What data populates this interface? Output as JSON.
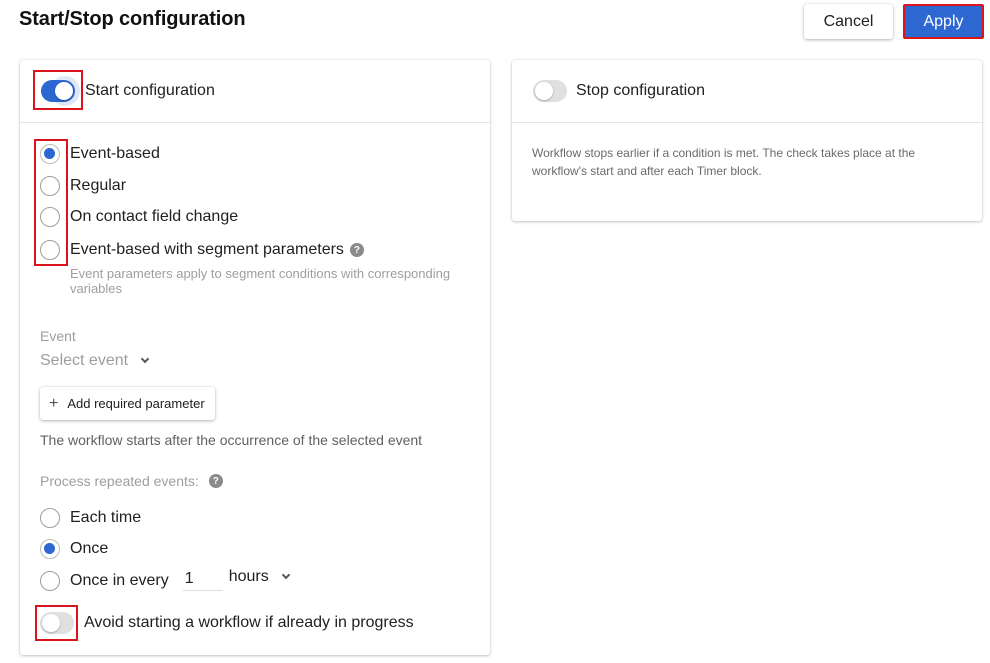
{
  "header": {
    "title": "Start/Stop configuration",
    "cancel_label": "Cancel",
    "apply_label": "Apply"
  },
  "start": {
    "toggle_on": true,
    "title": "Start configuration",
    "trigger_options": [
      {
        "label": "Event-based",
        "checked": true
      },
      {
        "label": "Regular",
        "checked": false
      },
      {
        "label": "On contact field change",
        "checked": false
      },
      {
        "label": "Event-based with segment parameters",
        "checked": false,
        "help": true
      }
    ],
    "segment_hint": "Event parameters apply to segment conditions with corresponding variables",
    "event_label": "Event",
    "event_placeholder": "Select event",
    "add_param_label": "Add required parameter",
    "description": "The workflow starts after the occurrence of the selected event",
    "repeat_label": "Process repeated events:",
    "repeat_options": [
      {
        "label": "Each time",
        "checked": false
      },
      {
        "label": "Once",
        "checked": true
      },
      {
        "label": "Once in every",
        "checked": false
      }
    ],
    "interval_value": "1",
    "interval_unit": "hours",
    "avoid_toggle_on": false,
    "avoid_label": "Avoid starting a workflow if already in progress"
  },
  "stop": {
    "toggle_on": false,
    "title": "Stop configuration",
    "description": "Workflow stops earlier if a condition is met. The check takes place at the workflow's start and after each Timer block."
  },
  "colors": {
    "accent": "#2d67d2",
    "highlight": "#d9141c"
  },
  "icons": {
    "help": "?",
    "plus": "+",
    "chevron": "chevron-down"
  }
}
